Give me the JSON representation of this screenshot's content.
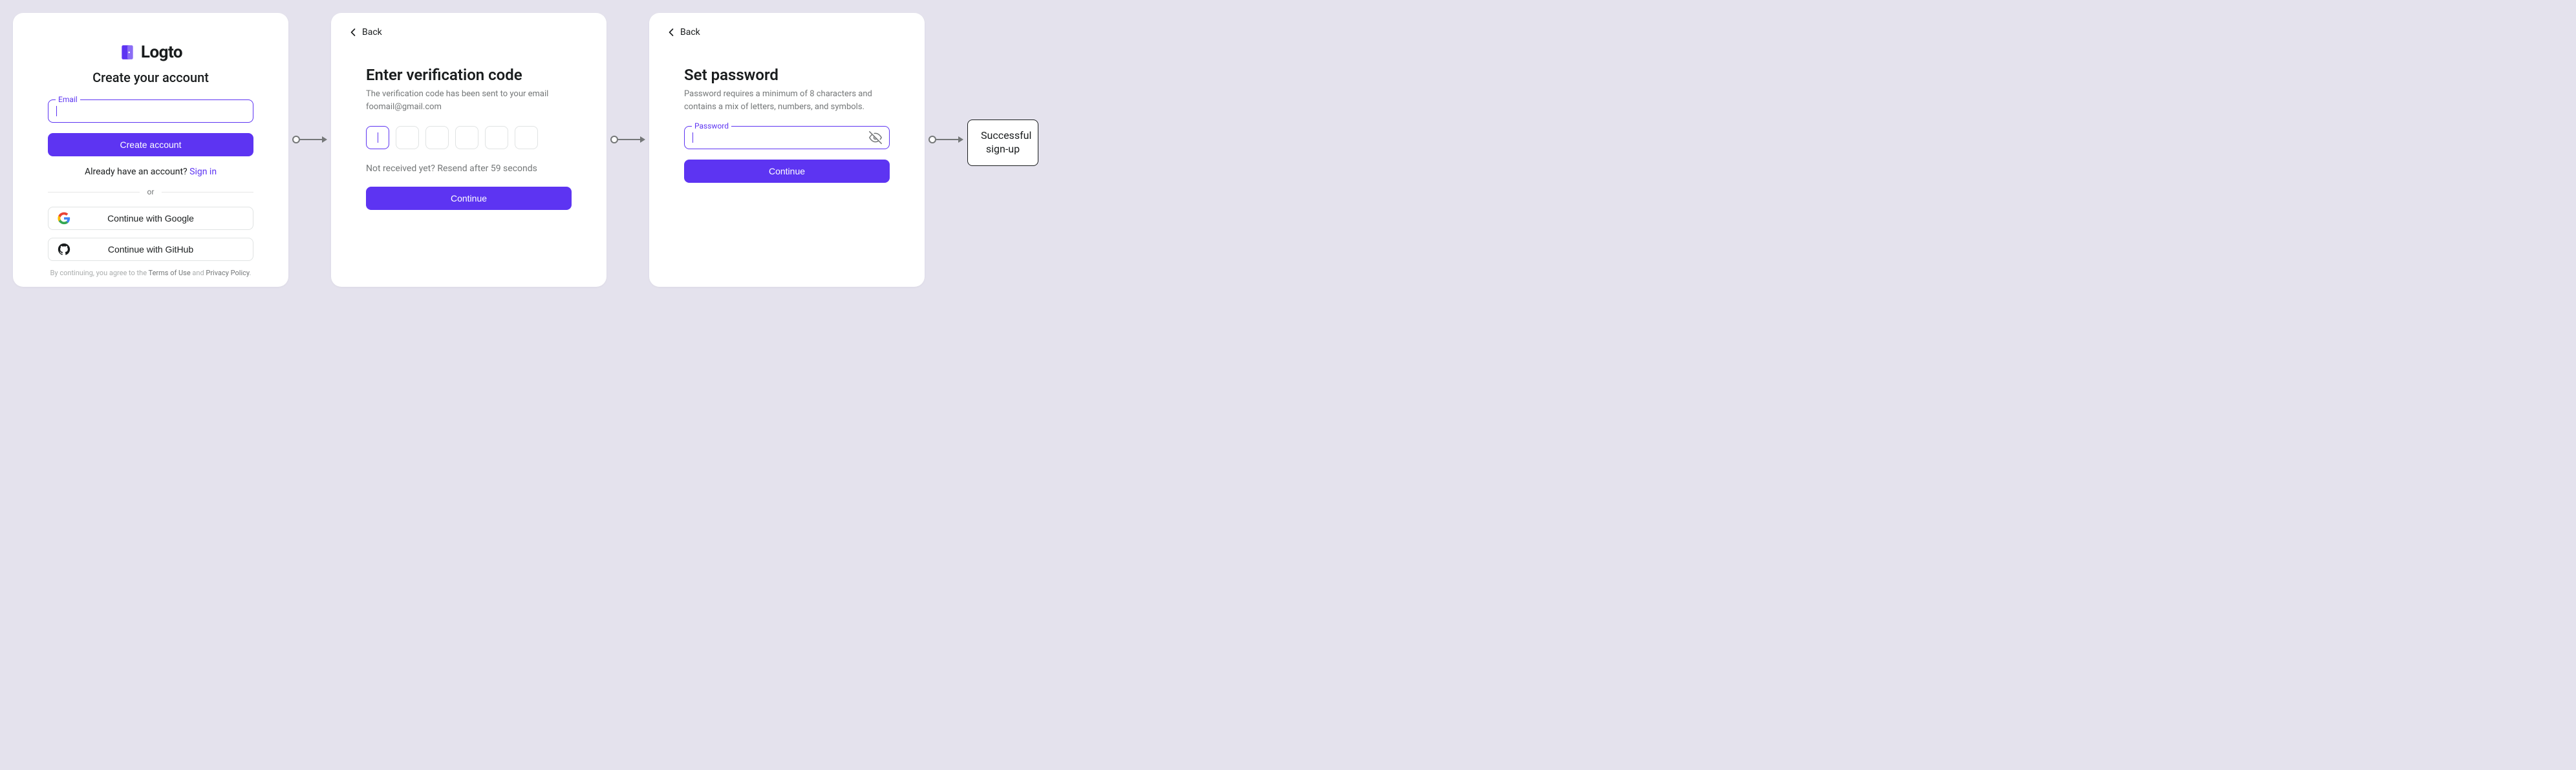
{
  "card1": {
    "brand": "Logto",
    "subtitle": "Create your account",
    "email_label": "Email",
    "create_btn": "Create account",
    "switch_prefix": "Already have an account? ",
    "switch_link": "Sign in",
    "divider": "or",
    "google_btn": "Continue with Google",
    "github_btn": "Continue with GitHub",
    "terms_prefix": "By continuing, you agree to the ",
    "terms_of_use": "Terms of Use",
    "terms_and": " and ",
    "privacy": "Privacy Policy",
    "terms_suffix": "."
  },
  "card2": {
    "back": "Back",
    "heading": "Enter verification code",
    "desc_line1": "The verification code has been sent to your email",
    "desc_email": "foomail@gmail.com",
    "resend": "Not received yet? Resend after 59 seconds",
    "continue_btn": "Continue"
  },
  "card3": {
    "back": "Back",
    "heading": "Set password",
    "desc": "Password requires a minimum of 8 characters and contains a mix of letters, numbers, and symbols.",
    "password_label": "Password",
    "continue_btn": "Continue"
  },
  "end": {
    "text": "Successful sign-up"
  }
}
